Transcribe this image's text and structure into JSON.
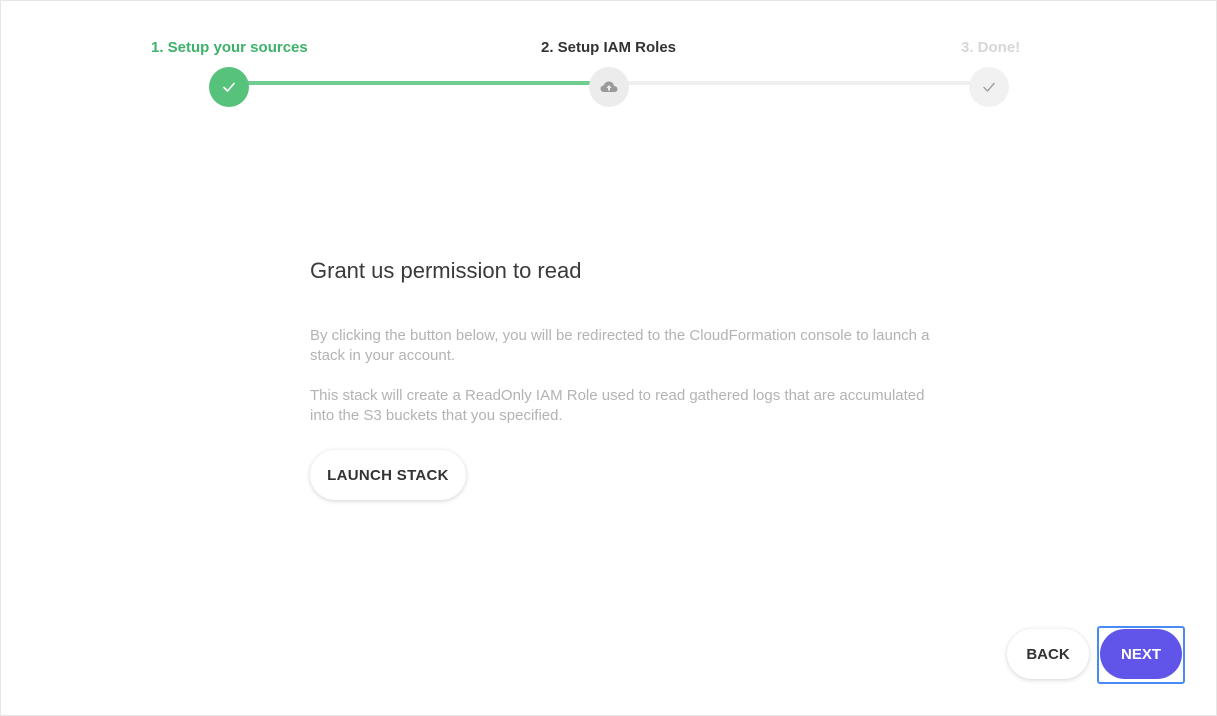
{
  "stepper": {
    "steps": [
      {
        "label": "1. Setup your sources",
        "state": "completed",
        "icon": "check-icon"
      },
      {
        "label": "2. Setup IAM Roles",
        "state": "current",
        "icon": "cloud-upload-icon"
      },
      {
        "label": "3. Done!",
        "state": "pending",
        "icon": "check-icon"
      }
    ],
    "colors": {
      "completed": "#3eb26a",
      "completed_node": "#57c27c",
      "completed_track": "#6fcd8d",
      "pending_track": "#efefef",
      "pending_text": "#d6d6d6"
    }
  },
  "content": {
    "heading": "Grant us permission to read",
    "paragraph_1": "By clicking the button below, you will be redirected to the CloudFormation console to launch a stack in your account.",
    "paragraph_2": "This stack will create a ReadOnly IAM Role used to read gathered logs that are accumulated into the S3 buckets that you specified.",
    "launch_button": "LAUNCH STACK"
  },
  "footer": {
    "back_label": "BACK",
    "next_label": "NEXT",
    "accent": "#6055e8",
    "focus_ring": "#4a8af4"
  }
}
